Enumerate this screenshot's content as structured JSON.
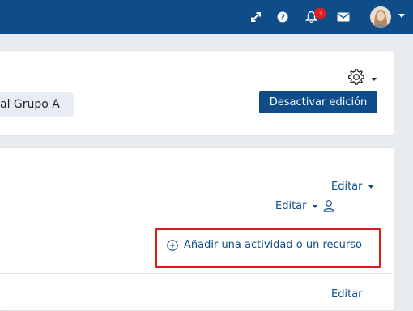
{
  "navbar": {
    "icons": [
      "expand-icon",
      "help-icon",
      "bell-icon",
      "mail-icon"
    ],
    "notification_count": "3",
    "brand_color": "#0f4c8a"
  },
  "header": {
    "group_filter": "al Grupo A",
    "settings_icon": "gear-icon",
    "toggle_edit_label": "Desactivar edición"
  },
  "section": {
    "edit_label_top": "Editar",
    "edit_label_second": "Editar",
    "add_activity_label": "Añadir una actividad o un recurso",
    "next_edit_label": "Editar",
    "highlight_color": "#e01818"
  }
}
